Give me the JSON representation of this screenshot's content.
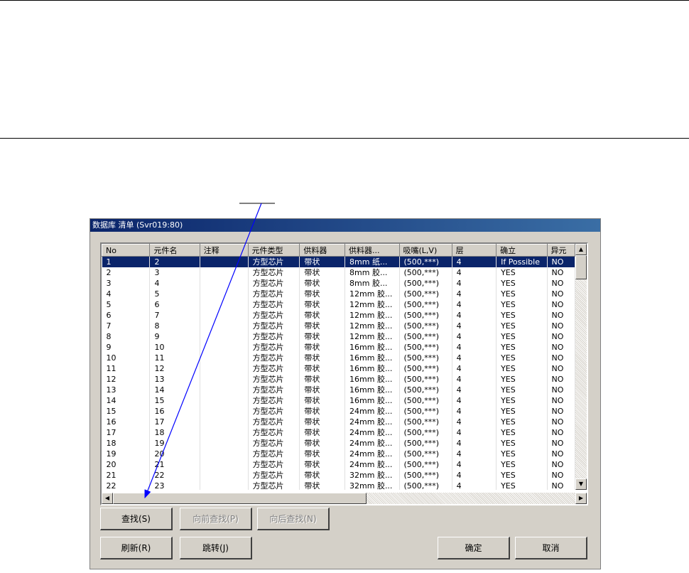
{
  "dialog": {
    "title": "数据库 清单 (Svr019:80)"
  },
  "table": {
    "columns": [
      "No",
      "元件名",
      "注释",
      "元件类型",
      "供料器",
      "供料器...",
      "吸嘴(L,V)",
      "层",
      "确立",
      "异元"
    ],
    "rows": [
      [
        "1",
        "2",
        "",
        "方型芯片",
        "带状",
        "8mm 纸...",
        "(500,***)",
        "4",
        "If Possible",
        "NO"
      ],
      [
        "2",
        "3",
        "",
        "方型芯片",
        "带状",
        "8mm 胶...",
        "(500,***)",
        "4",
        "YES",
        "NO"
      ],
      [
        "3",
        "4",
        "",
        "方型芯片",
        "带状",
        "8mm 胶...",
        "(500,***)",
        "4",
        "YES",
        "NO"
      ],
      [
        "4",
        "5",
        "",
        "方型芯片",
        "带状",
        "12mm 胶...",
        "(500,***)",
        "4",
        "YES",
        "NO"
      ],
      [
        "5",
        "6",
        "",
        "方型芯片",
        "带状",
        "12mm 胶...",
        "(500,***)",
        "4",
        "YES",
        "NO"
      ],
      [
        "6",
        "7",
        "",
        "方型芯片",
        "带状",
        "12mm 胶...",
        "(500,***)",
        "4",
        "YES",
        "NO"
      ],
      [
        "7",
        "8",
        "",
        "方型芯片",
        "带状",
        "12mm 胶...",
        "(500,***)",
        "4",
        "YES",
        "NO"
      ],
      [
        "8",
        "9",
        "",
        "方型芯片",
        "带状",
        "12mm 胶...",
        "(500,***)",
        "4",
        "YES",
        "NO"
      ],
      [
        "9",
        "10",
        "",
        "方型芯片",
        "带状",
        "16mm 胶...",
        "(500,***)",
        "4",
        "YES",
        "NO"
      ],
      [
        "10",
        "11",
        "",
        "方型芯片",
        "带状",
        "16mm 胶...",
        "(500,***)",
        "4",
        "YES",
        "NO"
      ],
      [
        "11",
        "12",
        "",
        "方型芯片",
        "带状",
        "16mm 胶...",
        "(500,***)",
        "4",
        "YES",
        "NO"
      ],
      [
        "12",
        "13",
        "",
        "方型芯片",
        "带状",
        "16mm 胶...",
        "(500,***)",
        "4",
        "YES",
        "NO"
      ],
      [
        "13",
        "14",
        "",
        "方型芯片",
        "带状",
        "16mm 胶...",
        "(500,***)",
        "4",
        "YES",
        "NO"
      ],
      [
        "14",
        "15",
        "",
        "方型芯片",
        "带状",
        "16mm 胶...",
        "(500,***)",
        "4",
        "YES",
        "NO"
      ],
      [
        "15",
        "16",
        "",
        "方型芯片",
        "带状",
        "24mm 胶...",
        "(500,***)",
        "4",
        "YES",
        "NO"
      ],
      [
        "16",
        "17",
        "",
        "方型芯片",
        "带状",
        "24mm 胶...",
        "(500,***)",
        "4",
        "YES",
        "NO"
      ],
      [
        "17",
        "18",
        "",
        "方型芯片",
        "带状",
        "24mm 胶...",
        "(500,***)",
        "4",
        "YES",
        "NO"
      ],
      [
        "18",
        "19",
        "",
        "方型芯片",
        "带状",
        "24mm 胶...",
        "(500,***)",
        "4",
        "YES",
        "NO"
      ],
      [
        "19",
        "20",
        "",
        "方型芯片",
        "带状",
        "24mm 胶...",
        "(500,***)",
        "4",
        "YES",
        "NO"
      ],
      [
        "20",
        "21",
        "",
        "方型芯片",
        "带状",
        "24mm 胶...",
        "(500,***)",
        "4",
        "YES",
        "NO"
      ],
      [
        "21",
        "22",
        "",
        "方型芯片",
        "带状",
        "32mm 胶...",
        "(500,***)",
        "4",
        "YES",
        "NO"
      ],
      [
        "22",
        "23",
        "",
        "方型芯片",
        "带状",
        "32mm 胶...",
        "(500,***)",
        "4",
        "YES",
        "NO"
      ]
    ]
  },
  "buttons": {
    "find": "查找(S)",
    "find_prev": "向前查找(P)",
    "find_next": "向后查找(N)",
    "refresh": "刷新(R)",
    "jump": "跳转(J)",
    "ok": "确定",
    "cancel": "取消"
  },
  "scroll_icons": [
    "scroll-up-icon",
    "scroll-down-icon",
    "scroll-left-icon",
    "scroll-right-icon"
  ],
  "colors": {
    "selection": "#0a246a",
    "titlebar": "#0a246a",
    "annotation_arrow": "#0000ff",
    "face": "#d4d0c8"
  }
}
